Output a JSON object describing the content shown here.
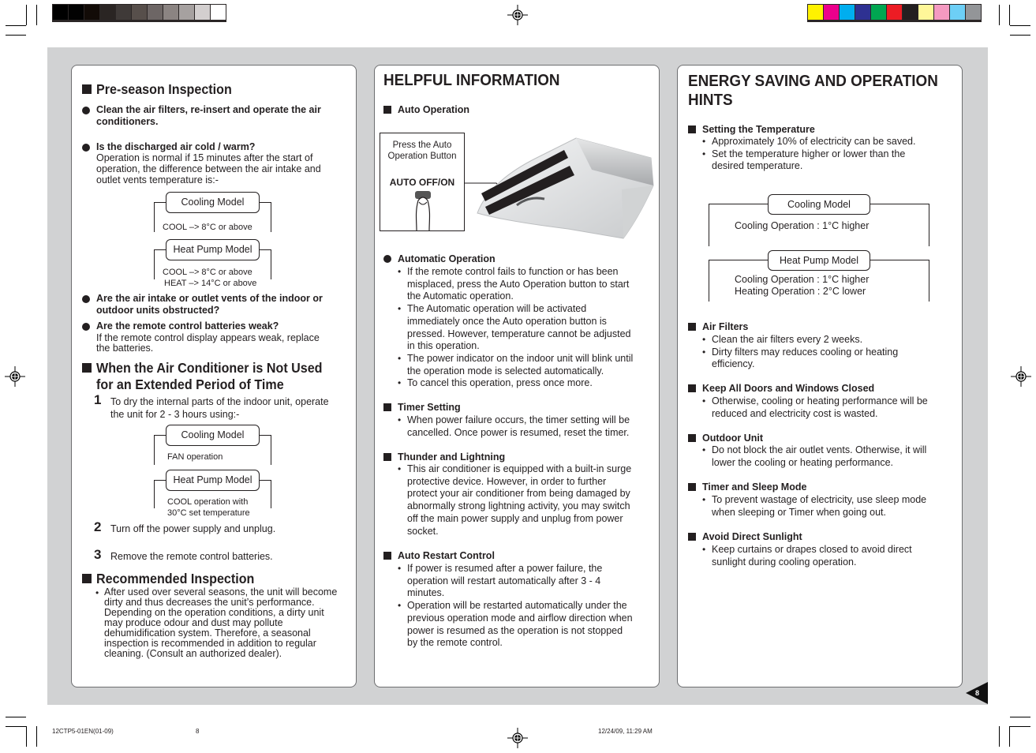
{
  "print_marks": {
    "grayscale_swatches": [
      "#000000",
      "#020202",
      "#120b07",
      "#2a2523",
      "#3f3a38",
      "#574f4b",
      "#6d6665",
      "#8b8482",
      "#a6a1a0",
      "#d3cfcf",
      "#ffffff"
    ],
    "color_swatches": [
      "#fff200",
      "#ec008c",
      "#00aeef",
      "#2e3192",
      "#00a651",
      "#ed1c24",
      "#231f20",
      "#fff799",
      "#f49ac1",
      "#6dcff6",
      "#939598"
    ]
  },
  "left": {
    "preseason": {
      "heading": "Pre-season Inspection",
      "item1": [
        "Clean the air filters, re-insert and operate the air",
        "conditioners."
      ],
      "item2_title": "Is the discharged air cold / warm?",
      "item2_body": [
        "Operation is normal if 15 minutes after the start of",
        "operation, the difference between the air intake and",
        "outlet vents temperature is:-"
      ],
      "cooling_label": "Cooling Model",
      "cooling_value": "COOL –> 8°C or above",
      "heatpump_label": "Heat Pump Model",
      "heatpump_values": [
        "COOL –> 8°C or above",
        "HEAT –> 14°C or above"
      ],
      "item3": [
        "Are the air intake or outlet vents of the indoor or",
        "outdoor units obstructed?"
      ],
      "item4_title": "Are the remote control batteries weak?",
      "item4_body": [
        "If the remote control display appears weak, replace",
        "the batteries."
      ]
    },
    "not_used": {
      "heading": [
        "When the Air Conditioner is Not Used",
        "for an Extended Period of Time"
      ],
      "step1_num": "1",
      "step1": [
        "To dry the internal parts of the indoor unit, operate",
        "the unit for 2 - 3 hours using:-"
      ],
      "cooling_label": "Cooling Model",
      "cooling_value": "FAN operation",
      "heatpump_label": "Heat Pump Model",
      "heatpump_values": [
        "COOL operation with",
        "30°C set temperature"
      ],
      "step2_num": "2",
      "step2": "Turn off the power supply and unplug.",
      "step3_num": "3",
      "step3": "Remove the remote control batteries."
    },
    "recommended": {
      "heading": "Recommended Inspection",
      "body": [
        "After used over several seasons, the unit will become",
        "dirty and thus decreases the unit’s performance.",
        "Depending on the operation conditions, a dirty unit",
        "may produce odour and dust may pollute",
        "dehumidification system. Therefore, a seasonal",
        "inspection is recommended in addition to regular",
        "cleaning. (Consult an authorized dealer)."
      ]
    }
  },
  "middle": {
    "title": "HELPFUL INFORMATION",
    "auto_op": {
      "heading": "Auto Operation",
      "callout": [
        "Press the Auto",
        "Operation Button"
      ],
      "button_label": "AUTO OFF/ON"
    },
    "automatic": {
      "heading": "Automatic Operation",
      "bullets": [
        [
          "If the remote control fails to function or has been",
          "misplaced, press the Auto Operation button to start",
          "the Automatic operation."
        ],
        [
          "The Automatic operation will be activated",
          "immediately once the Auto operation button is",
          "pressed. However, temperature cannot be adjusted",
          "in this operation."
        ],
        [
          "The power indicator on the indoor unit will blink until",
          "the operation mode is selected automatically."
        ],
        [
          "To cancel this operation, press once more."
        ]
      ]
    },
    "timer": {
      "heading": "Timer Setting",
      "bullets": [
        [
          "When power failure occurs, the timer setting will be",
          "cancelled. Once power is resumed, reset the timer."
        ]
      ]
    },
    "thunder": {
      "heading": "Thunder and Lightning",
      "bullets": [
        [
          "This air conditioner is equipped with a built-in surge",
          "protective device. However, in order to further",
          "protect your air conditioner from being damaged by",
          "abnormally strong lightning activity, you may switch",
          "off the main power supply and unplug from power",
          "socket."
        ]
      ]
    },
    "restart": {
      "heading": "Auto Restart Control",
      "bullets": [
        [
          "If power is resumed after a power failure, the",
          "operation will restart automatically after 3 - 4",
          "minutes."
        ],
        [
          "Operation will be restarted automatically under the",
          "previous operation mode and airflow direction when",
          "power is resumed as the operation is not stopped",
          "by the remote control."
        ]
      ]
    }
  },
  "right": {
    "title": [
      "ENERGY SAVING AND OPERATION",
      "HINTS"
    ],
    "temp": {
      "heading": "Setting the Temperature",
      "bullets": [
        [
          "Approximately 10% of electricity can be saved."
        ],
        [
          "Set the temperature higher or lower than the",
          "desired temperature."
        ]
      ],
      "cooling_label": "Cooling Model",
      "cooling_value": "Cooling Operation : 1°C higher",
      "heatpump_label": "Heat Pump Model",
      "heatpump_values": [
        "Cooling Operation : 1°C higher",
        "Heating Operation : 2°C lower"
      ]
    },
    "filters": {
      "heading": "Air Filters",
      "bullets": [
        [
          "Clean the air filters every 2 weeks."
        ],
        [
          "Dirty filters may reduces cooling or heating",
          "efficiency."
        ]
      ]
    },
    "doors": {
      "heading": "Keep All Doors and Windows Closed",
      "bullets": [
        [
          "Otherwise, cooling or heating performance will be",
          "reduced and electricity cost is wasted."
        ]
      ]
    },
    "outdoor": {
      "heading": "Outdoor Unit",
      "bullets": [
        [
          "Do not block the air outlet vents. Otherwise, it will",
          "lower the cooling or heating performance."
        ]
      ]
    },
    "sleep": {
      "heading": "Timer and Sleep Mode",
      "bullets": [
        [
          "To prevent wastage of electricity, use sleep mode",
          "when sleeping or Timer when going out."
        ]
      ]
    },
    "sunlight": {
      "heading": "Avoid Direct Sunlight",
      "bullets": [
        [
          "Keep curtains or drapes closed to avoid direct",
          "sunlight during cooling operation."
        ]
      ]
    }
  },
  "page_number": "8",
  "footer": {
    "doc_code": "12CTP5-01EN(01-09)",
    "page": "8",
    "timestamp": "12/24/09, 11:29 AM"
  }
}
